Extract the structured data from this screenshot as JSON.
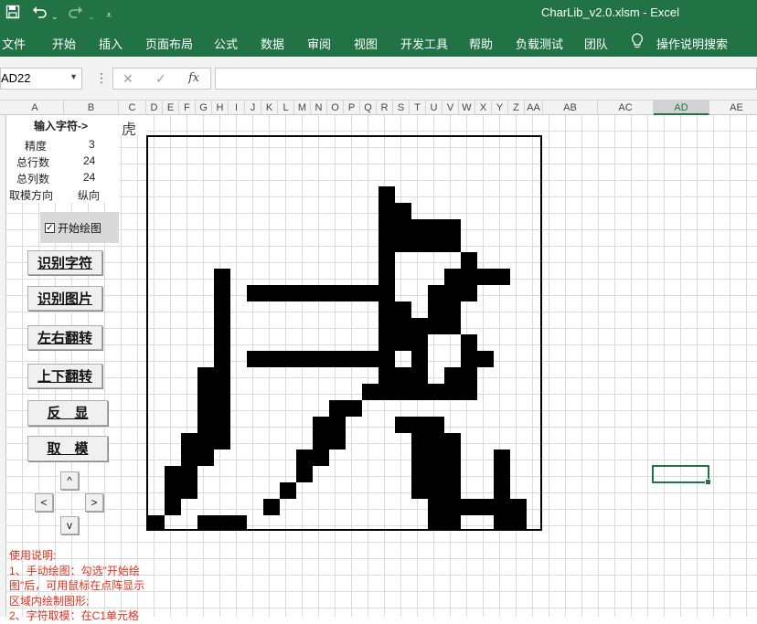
{
  "window": {
    "title": "CharLib_v2.0.xlsm  -  Excel",
    "save_icon": "save-icon",
    "undo_icon": "undo-icon",
    "redo_icon": "redo-icon",
    "qat_icon": "customize-qat-icon"
  },
  "ribbon": {
    "tabs": [
      "文件",
      "开始",
      "插入",
      "页面布局",
      "公式",
      "数据",
      "审阅",
      "视图",
      "开发工具",
      "帮助",
      "负载测试",
      "团队"
    ],
    "tell_me_icon": "lightbulb-icon",
    "tell_me": "操作说明搜索"
  },
  "formula_bar": {
    "name_box": "AD22",
    "cancel": "✕",
    "enter": "✓",
    "fx": "fx",
    "formula": ""
  },
  "columns": [
    "A",
    "B",
    "C",
    "D",
    "E",
    "F",
    "G",
    "H",
    "I",
    "J",
    "K",
    "L",
    "M",
    "N",
    "O",
    "P",
    "Q",
    "R",
    "S",
    "T",
    "U",
    "V",
    "W",
    "X",
    "Y",
    "Z",
    "AA",
    "AB",
    "AC",
    "AD",
    "AE"
  ],
  "sheet": {
    "input_label": "输入字符->",
    "input_char": "虎",
    "params": [
      {
        "label": "精度",
        "value": "3"
      },
      {
        "label": "总行数",
        "value": "24"
      },
      {
        "label": "总列数",
        "value": "24"
      },
      {
        "label": "取模方向",
        "value": "纵向"
      }
    ],
    "draw_checkbox": {
      "label": "开始绘图",
      "checked": true
    },
    "buttons": [
      "识别字符",
      "识别图片",
      "左右翻转",
      "上下翻转",
      "反　显",
      "取　模"
    ],
    "arrows": {
      "up": "^",
      "left": "<",
      "right": ">",
      "down": "v"
    },
    "notes": [
      "使用说明:",
      "1、手动绘图：勾选\"开始绘",
      "图\"后，可用鼠标在点阵显示",
      "区域内绘制图形;",
      "2、字符取模：在C1单元格"
    ]
  },
  "bitmap": {
    "rows": 24,
    "cols": 24,
    "pixels": [
      "........................",
      "........................",
      "........................",
      "..............#.........",
      "..............##........",
      "..............#####.....",
      "..............#####.....",
      "..............#....#....",
      "....#.........#...####..",
      "....#.#########..###....",
      "....#.........##.##.....",
      "....#.........#####.....",
      "....#.........###..#....",
      "....#.#########.#..##...",
      "...##.........###.##....",
      "...##........#######....",
      "...##......##...........",
      "...##.....##...###......",
      "..###.....##....###.....",
      "..##.....##.....###..#..",
      ".##......#......###..#..",
      ".##.....#.......###..#..",
      ".#.....#.........######.",
      "#..###...........##..##."
    ]
  }
}
